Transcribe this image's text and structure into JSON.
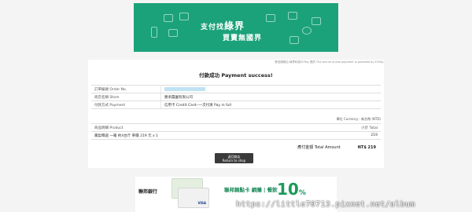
{
  "banner": {
    "line1_prefix": "支付找",
    "line1_brand": "綠界",
    "line2": "買賣無國界"
  },
  "provider_note": "發信服務由 綠界科技ECPay 提供 The secure online payment is provided by ECPay.",
  "page_title": "付款成功 Payment success!",
  "info_rows": [
    {
      "label": "訂單編號 Order No.",
      "value": ""
    },
    {
      "label": "商店名稱 Store",
      "value": "勝承農園有限公司"
    },
    {
      "label": "付款方式 Payment",
      "value": "信用卡 Credit Card--一次付清 Pay in full"
    }
  ],
  "currency_note": "單位 Currency：新台幣 (NTD)",
  "items": {
    "header": {
      "product": "商品明細 Product",
      "subtotal": "小計 Total"
    },
    "rows": [
      {
        "product": "鳳梨釋迦 一箱 約4台斤 單價 219 元 x 1",
        "subtotal": "219"
      }
    ]
  },
  "total": {
    "label": "應付金額 Total Amount",
    "value": "NT$ 219"
  },
  "back_button": {
    "line1": "返回商店",
    "line2": "Return to shop"
  },
  "ad": {
    "logo": "聯邦銀行",
    "text": "聯邦賴點卡 網購 | 餐飲",
    "percent": "10",
    "percent_sign": "%",
    "card_brand": "VISA"
  },
  "watermark": "https://little70713.pixnet.net/album",
  "colors": {
    "banner": "#1ba27a",
    "button": "#3a3a3a",
    "ad_accent": "#1a9a5a"
  }
}
